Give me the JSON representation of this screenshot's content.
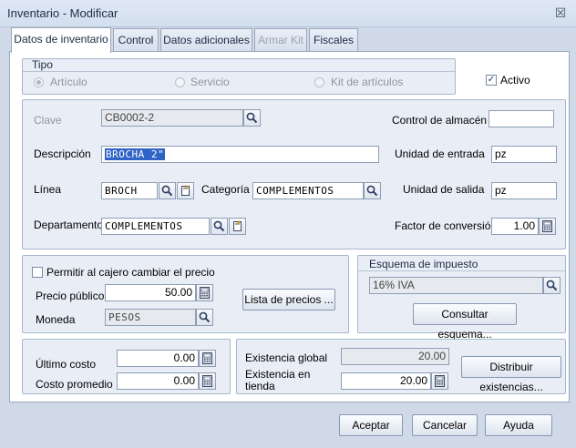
{
  "window": {
    "title": "Inventario - Modificar"
  },
  "tabs": [
    {
      "label": "Datos de inventario"
    },
    {
      "label": "Control"
    },
    {
      "label": "Datos adicionales"
    },
    {
      "label": "Armar Kit"
    },
    {
      "label": "Fiscales"
    }
  ],
  "tipo": {
    "title": "Tipo",
    "options": [
      {
        "label": "Artículo",
        "selected": true
      },
      {
        "label": "Servicio",
        "selected": false
      },
      {
        "label": "Kit de artículos",
        "selected": false
      }
    ]
  },
  "activo": {
    "label": "Activo",
    "checked": true,
    "mark": "✓"
  },
  "product": {
    "clave_label": "Clave",
    "clave_value": "CB0002-2",
    "descripcion_label": "Descripción",
    "descripcion_value": "BROCHA 2\"",
    "linea_label": "Línea",
    "linea_value": "BROCH",
    "categoria_label": "Categoría",
    "categoria_value": "COMPLEMENTOS",
    "departamento_label": "Departamento",
    "departamento_value": "COMPLEMENTOS",
    "control_almacen_label": "Control de almacén",
    "control_almacen_value": "",
    "unidad_entrada_label": "Unidad de entrada",
    "unidad_entrada_value": "pz",
    "unidad_salida_label": "Unidad de salida",
    "unidad_salida_value": "pz",
    "factor_label": "Factor de conversión",
    "factor_value": "1.00"
  },
  "precio": {
    "cajero_label": "Permitir al cajero cambiar el precio",
    "cajero_checked": false,
    "precio_publico_label": "Precio público",
    "precio_publico_value": "50.00",
    "moneda_label": "Moneda",
    "moneda_value": "PESOS",
    "lista_precios_label": "Lista de precios ..."
  },
  "impuesto": {
    "title": "Esquema de impuesto",
    "value": "16% IVA",
    "consultar_label": "Consultar esquema..."
  },
  "costos": {
    "ultimo_costo_label": "Último costo",
    "ultimo_costo_value": "0.00",
    "costo_promedio_label": "Costo promedio",
    "costo_promedio_value": "0.00"
  },
  "existencias": {
    "global_label": "Existencia global",
    "global_value": "20.00",
    "tienda_label_1": "Existencia  en",
    "tienda_label_2": "tienda",
    "tienda_value": "20.00",
    "distribuir_label": "Distribuir existencias..."
  },
  "buttons": {
    "aceptar": "Aceptar",
    "cancelar": "Cancelar",
    "ayuda": "Ayuda"
  },
  "icons": {
    "search": "magnifier-icon",
    "new": "new-document-icon",
    "calculator": "calculator-icon",
    "close": "close-icon",
    "close_glyph": "☒"
  }
}
